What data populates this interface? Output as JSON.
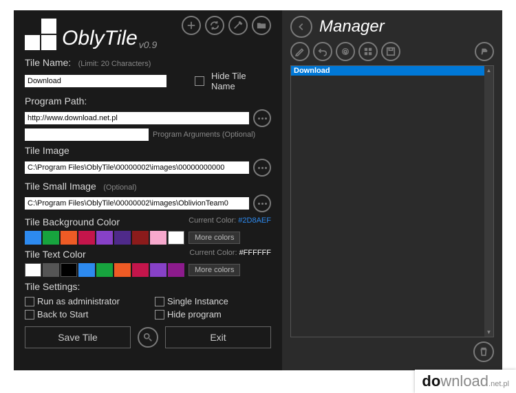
{
  "app": {
    "name": "OblyTile",
    "version": "v0.9"
  },
  "tileName": {
    "label": "Tile Name:",
    "hint": "(Limit: 20 Characters)",
    "value": "Download",
    "hideLabel": "Hide Tile Name"
  },
  "programPath": {
    "label": "Program Path:",
    "value": "http://www.download.net.pl",
    "argsHint": "Program Arguments (Optional)",
    "argsValue": ""
  },
  "tileImage": {
    "label": "Tile Image",
    "value": "C:\\Program Files\\OblyTile\\00000002\\images\\00000000000"
  },
  "tileSmallImage": {
    "label": "Tile Small Image",
    "hint": "(Optional)",
    "value": "C:\\Program Files\\OblyTile\\00000002\\images\\OblivionTeam0"
  },
  "bgColor": {
    "label": "Tile Background Color",
    "currentLabel": "Current Color:",
    "currentValue": "#2D8AEF",
    "swatches": [
      "#2D8AEF",
      "#17a33e",
      "#ee5b25",
      "#c4154b",
      "#8741c7",
      "#4f2a8a",
      "#8c1b1b",
      "#f7a9cd",
      "#ffffff"
    ],
    "more": "More colors"
  },
  "textColor": {
    "label": "Tile Text Color",
    "currentLabel": "Current Color:",
    "currentValue": "#FFFFFF",
    "swatches": [
      "#ffffff",
      "#555555",
      "#000000",
      "#2D8AEF",
      "#17a33e",
      "#ee5b25",
      "#c4154b",
      "#8741c7",
      "#8c1b8c"
    ],
    "more": "More colors"
  },
  "settings": {
    "label": "Tile Settings:",
    "runAsAdmin": "Run as administrator",
    "singleInstance": "Single Instance",
    "backToStart": "Back to Start",
    "hideProgram": "Hide program"
  },
  "buttons": {
    "save": "Save Tile",
    "exit": "Exit"
  },
  "manager": {
    "title": "Manager",
    "items": [
      "Download"
    ]
  },
  "watermark": {
    "t1": "do",
    "t2": "wnload",
    "t3": ".net.pl"
  }
}
